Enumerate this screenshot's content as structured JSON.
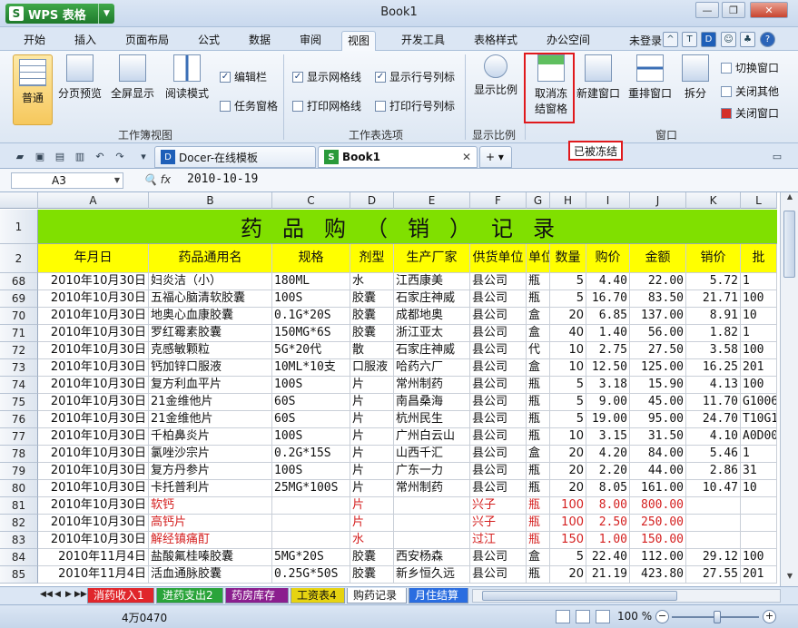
{
  "window": {
    "title": "Book1",
    "app_button": "WPS 表格"
  },
  "menu": {
    "tabs": [
      "开始",
      "插入",
      "页面布局",
      "公式",
      "数据",
      "审阅",
      "视图",
      "开发工具",
      "表格样式",
      "办公空间"
    ],
    "active_tab": "视图",
    "login": "未登录"
  },
  "ribbon": {
    "workbook_view": {
      "label": "工作簿视图",
      "buttons": [
        "普通",
        "分页预览",
        "全屏显示",
        "阅读模式"
      ],
      "checks": [
        {
          "label": "编辑栏",
          "checked": true
        },
        {
          "label": "任务窗格",
          "checked": false
        }
      ]
    },
    "options": {
      "label": "工作表选项",
      "checks": [
        {
          "label": "显示网格线",
          "checked": true
        },
        {
          "label": "显示行号列标",
          "checked": true
        },
        {
          "label": "打印网格线",
          "checked": false
        },
        {
          "label": "打印行号列标",
          "checked": false
        }
      ]
    },
    "zoom": {
      "label": "显示比例",
      "button": "显示比例"
    },
    "window": {
      "label": "窗口",
      "freeze_line1": "取消冻",
      "freeze_line2": "结窗格",
      "new_window": "新建窗口",
      "arrange": "重排窗口",
      "split": "拆分",
      "side": [
        "切换窗口",
        "关闭其他",
        "关闭窗口"
      ]
    }
  },
  "doc_tabs": [
    {
      "label": "Docer-在线模板",
      "active": false
    },
    {
      "label": "Book1",
      "active": true
    }
  ],
  "frozen_tip": "已被冻结",
  "formula_bar": {
    "cell_ref": "A3",
    "fx": "fx",
    "value": "2010-10-19"
  },
  "sheet": {
    "columns": [
      "A",
      "B",
      "C",
      "D",
      "E",
      "F",
      "G",
      "H",
      "I",
      "J",
      "K",
      "L"
    ],
    "title": "药品购（销）记录",
    "headers": [
      "年月日",
      "药品通用名",
      "规格",
      "剂型",
      "生产厂家",
      "供货单位",
      "单位",
      "数量",
      "购价",
      "金额",
      "销价",
      "批"
    ],
    "rows": [
      {
        "n": "68",
        "date": "2010年10月30日",
        "name": "妇炎洁（小）",
        "spec": "180ML",
        "form": "水",
        "maker": "江西康美",
        "supplier": "县公司",
        "unit": "瓶",
        "qty": "5",
        "price": "4.40",
        "amount": "22.00",
        "sale": "5.72",
        "batch": "1",
        "red": false
      },
      {
        "n": "69",
        "date": "2010年10月30日",
        "name": "五福心脑清软胶囊",
        "spec": "100S",
        "form": "胶囊",
        "maker": "石家庄神威",
        "supplier": "县公司",
        "unit": "瓶",
        "qty": "5",
        "price": "16.70",
        "amount": "83.50",
        "sale": "21.71",
        "batch": "100",
        "red": false
      },
      {
        "n": "70",
        "date": "2010年10月30日",
        "name": "地奥心血康胶囊",
        "spec": "0.1G*20S",
        "form": "胶囊",
        "maker": "成都地奥",
        "supplier": "县公司",
        "unit": "盒",
        "qty": "20",
        "price": "6.85",
        "amount": "137.00",
        "sale": "8.91",
        "batch": "10",
        "red": false
      },
      {
        "n": "71",
        "date": "2010年10月30日",
        "name": "罗红霉素胶囊",
        "spec": "150MG*6S",
        "form": "胶囊",
        "maker": "浙江亚太",
        "supplier": "县公司",
        "unit": "盒",
        "qty": "40",
        "price": "1.40",
        "amount": "56.00",
        "sale": "1.82",
        "batch": "1",
        "red": false
      },
      {
        "n": "72",
        "date": "2010年10月30日",
        "name": "克感敏颗粒",
        "spec": "5G*20代",
        "form": "散",
        "maker": "石家庄神威",
        "supplier": "县公司",
        "unit": "代",
        "qty": "10",
        "price": "2.75",
        "amount": "27.50",
        "sale": "3.58",
        "batch": "100",
        "red": false
      },
      {
        "n": "73",
        "date": "2010年10月30日",
        "name": "钙加锌口服液",
        "spec": "10ML*10支",
        "form": "口服液",
        "maker": "哈药六厂",
        "supplier": "县公司",
        "unit": "盒",
        "qty": "10",
        "price": "12.50",
        "amount": "125.00",
        "sale": "16.25",
        "batch": "201",
        "red": false
      },
      {
        "n": "74",
        "date": "2010年10月30日",
        "name": "复方利血平片",
        "spec": "100S",
        "form": "片",
        "maker": "常州制药",
        "supplier": "县公司",
        "unit": "瓶",
        "qty": "5",
        "price": "3.18",
        "amount": "15.90",
        "sale": "4.13",
        "batch": "100",
        "red": false
      },
      {
        "n": "75",
        "date": "2010年10月30日",
        "name": "21金维他片",
        "spec": "60S",
        "form": "片",
        "maker": "南昌桑海",
        "supplier": "县公司",
        "unit": "瓶",
        "qty": "5",
        "price": "9.00",
        "amount": "45.00",
        "sale": "11.70",
        "batch": "G1006",
        "red": false
      },
      {
        "n": "76",
        "date": "2010年10月30日",
        "name": "21金维他片",
        "spec": "60S",
        "form": "片",
        "maker": "杭州民生",
        "supplier": "县公司",
        "unit": "瓶",
        "qty": "5",
        "price": "19.00",
        "amount": "95.00",
        "sale": "24.70",
        "batch": "T10G1",
        "red": false
      },
      {
        "n": "77",
        "date": "2010年10月30日",
        "name": "千柏鼻炎片",
        "spec": "100S",
        "form": "片",
        "maker": "广州白云山",
        "supplier": "县公司",
        "unit": "瓶",
        "qty": "10",
        "price": "3.15",
        "amount": "31.50",
        "sale": "4.10",
        "batch": "A0D00",
        "red": false
      },
      {
        "n": "78",
        "date": "2010年10月30日",
        "name": "氯唑沙宗片",
        "spec": "0.2G*15S",
        "form": "片",
        "maker": "山西千汇",
        "supplier": "县公司",
        "unit": "盒",
        "qty": "20",
        "price": "4.20",
        "amount": "84.00",
        "sale": "5.46",
        "batch": "1",
        "red": false
      },
      {
        "n": "79",
        "date": "2010年10月30日",
        "name": "复方丹参片",
        "spec": "100S",
        "form": "片",
        "maker": "广东一力",
        "supplier": "县公司",
        "unit": "瓶",
        "qty": "20",
        "price": "2.20",
        "amount": "44.00",
        "sale": "2.86",
        "batch": "31",
        "red": false
      },
      {
        "n": "80",
        "date": "2010年10月30日",
        "name": "卡托普利片",
        "spec": "25MG*100S",
        "form": "片",
        "maker": "常州制药",
        "supplier": "县公司",
        "unit": "瓶",
        "qty": "20",
        "price": "8.05",
        "amount": "161.00",
        "sale": "10.47",
        "batch": "10",
        "red": false
      },
      {
        "n": "81",
        "date": "2010年10月30日",
        "name": "软钙",
        "spec": "",
        "form": "片",
        "maker": "",
        "supplier": "兴子",
        "unit": "瓶",
        "qty": "100",
        "price": "8.00",
        "amount": "800.00",
        "sale": "",
        "batch": "",
        "red": true
      },
      {
        "n": "82",
        "date": "2010年10月30日",
        "name": "高钙片",
        "spec": "",
        "form": "片",
        "maker": "",
        "supplier": "兴子",
        "unit": "瓶",
        "qty": "100",
        "price": "2.50",
        "amount": "250.00",
        "sale": "",
        "batch": "",
        "red": true
      },
      {
        "n": "83",
        "date": "2010年10月30日",
        "name": "解经镇痛酊",
        "spec": "",
        "form": "水",
        "maker": "",
        "supplier": "过江",
        "unit": "瓶",
        "qty": "150",
        "price": "1.00",
        "amount": "150.00",
        "sale": "",
        "batch": "",
        "red": true
      },
      {
        "n": "84",
        "date": "2010年11月4日",
        "name": "盐酸氟桂嗪胶囊",
        "spec": "5MG*20S",
        "form": "胶囊",
        "maker": "西安杨森",
        "supplier": "县公司",
        "unit": "盒",
        "qty": "5",
        "price": "22.40",
        "amount": "112.00",
        "sale": "29.12",
        "batch": "100",
        "red": false
      },
      {
        "n": "85",
        "date": "2010年11月4日",
        "name": "活血通脉胶囊",
        "spec": "0.25G*50S",
        "form": "胶囊",
        "maker": "新乡恒久远",
        "supplier": "县公司",
        "unit": "瓶",
        "qty": "20",
        "price": "21.19",
        "amount": "423.80",
        "sale": "27.55",
        "batch": "201",
        "red": false
      }
    ]
  },
  "sheet_tabs": [
    {
      "label": "消药收入1",
      "color": "#e0262b",
      "active": false
    },
    {
      "label": "进药支出2",
      "color": "#2aa43a",
      "active": false
    },
    {
      "label": "药房库存",
      "color": "#8b1e8e",
      "active": false
    },
    {
      "label": "工资表4",
      "color": "#e6d311",
      "active": false
    },
    {
      "label": "购药记录",
      "color": "#ffffff",
      "active": true
    },
    {
      "label": "月住结算",
      "color": "#2a6de0",
      "active": false
    }
  ],
  "status": {
    "text": "4万0470",
    "zoom": "100 %"
  }
}
